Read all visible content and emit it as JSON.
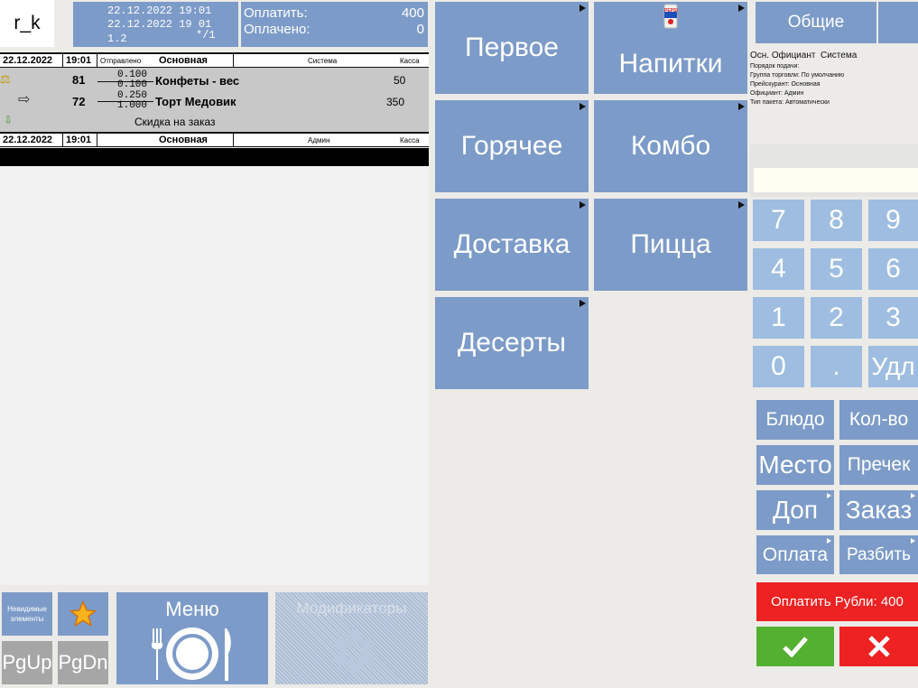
{
  "header": {
    "user": "r_k",
    "date1": "22.12.2022 19:01",
    "date2": "22.12.2022 19 01",
    "version": "1.2",
    "guests": "*/1",
    "pay_label": "Оплатить:",
    "pay_value": "400",
    "paid_label": "Оплачено:",
    "paid_value": "0"
  },
  "order": {
    "header1": {
      "date": "22.12.2022",
      "time": "19:01",
      "status": "Отправлено",
      "name": "Основная",
      "user": "Система",
      "station": "Касса"
    },
    "items": [
      {
        "qty": "81",
        "frac_top": "0.100",
        "frac_bottom": "0.100",
        "name": "Конфеты - вес",
        "price": "50"
      },
      {
        "qty": "72",
        "frac_top": "0.250",
        "frac_bottom": "1.000",
        "name": "Торт Медовик",
        "price": "350"
      }
    ],
    "discount": "Скидка на заказ",
    "header2": {
      "date": "22.12.2022",
      "time": "19:01",
      "name": "Основная",
      "user": "Админ",
      "station": "Касса"
    }
  },
  "bottom": {
    "invisible_label": "Невидимые элементы",
    "pgup": "PgUp",
    "pgdn": "PgDn",
    "menu": "Меню",
    "modifiers": "Модификаторы"
  },
  "categories": {
    "first": "Первое",
    "drinks": "Напитки",
    "hot": "Горячее",
    "combo": "Комбо",
    "delivery": "Доставка",
    "pizza": "Пицца",
    "desserts": "Десерты",
    "pepsi_logo": "PEPSI"
  },
  "info": {
    "tab_general": "Общие",
    "line1": "Осн. Официант  Система",
    "line2": "Порядок подачи:",
    "line3": "Группа торговли: По умолчанию",
    "line4": "Прейскурант: Основная",
    "line5": "Официант: Админ",
    "line6": "Тип пакета: Автоматически"
  },
  "keypad": {
    "k7": "7",
    "k8": "8",
    "k9": "9",
    "k4": "4",
    "k5": "5",
    "k6": "6",
    "k1": "1",
    "k2": "2",
    "k3": "3",
    "k0": "0",
    "kdot": ".",
    "kdel": "Удл"
  },
  "actions": {
    "dish": "Блюдо",
    "qty": "Кол-во",
    "place": "Место",
    "receipt": "Пречек",
    "extra": "Доп",
    "order": "Заказ",
    "payment": "Оплата",
    "split": "Разбить",
    "pay_rub": "Оплатить Рубли: 400"
  },
  "colors": {
    "tile": "#7d9bc8",
    "keypad": "#9ebde0",
    "pay_red": "#ee2222",
    "ok_green": "#54b030"
  }
}
